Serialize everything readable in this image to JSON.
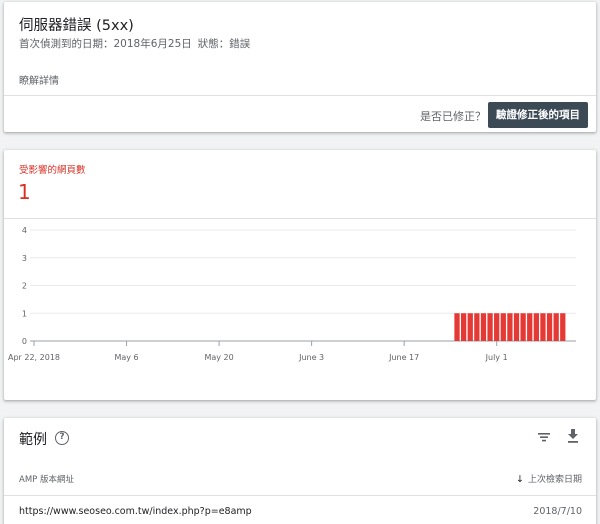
{
  "issue": {
    "title": "伺服器錯誤 (5xx)",
    "first_detected_label": "首次偵測到的日期：",
    "first_detected_date": "2018年6月25日",
    "status_label": "狀態：",
    "status_value": "錯誤",
    "learn_more": "瞭解詳情",
    "fixed_question": "是否已修正？",
    "validate_button": "驗證修正後的項目"
  },
  "stats": {
    "label": "受影響的網頁數",
    "value": "1"
  },
  "chart_data": {
    "type": "bar",
    "series_color": "#e53935",
    "ylim": [
      0,
      4
    ],
    "yticks": [
      "0",
      "1",
      "2",
      "3",
      "4"
    ],
    "xtick_labels": [
      "Apr 22, 2018",
      "May 6",
      "May 20",
      "June 3",
      "June 17",
      "July 1"
    ],
    "day_range": [
      0,
      82
    ],
    "xtick_days": [
      0,
      14,
      28,
      42,
      56,
      70
    ],
    "bars": [
      {
        "day": 64,
        "value": 1
      },
      {
        "day": 65,
        "value": 1
      },
      {
        "day": 66,
        "value": 1
      },
      {
        "day": 67,
        "value": 1
      },
      {
        "day": 68,
        "value": 1
      },
      {
        "day": 69,
        "value": 1
      },
      {
        "day": 70,
        "value": 1
      },
      {
        "day": 71,
        "value": 1
      },
      {
        "day": 72,
        "value": 1
      },
      {
        "day": 73,
        "value": 1
      },
      {
        "day": 74,
        "value": 1
      },
      {
        "day": 75,
        "value": 1
      },
      {
        "day": 76,
        "value": 1
      },
      {
        "day": 77,
        "value": 1
      },
      {
        "day": 78,
        "value": 1
      },
      {
        "day": 79,
        "value": 1
      },
      {
        "day": 80,
        "value": 1
      }
    ],
    "grid": true
  },
  "examples": {
    "title": "範例",
    "help_icon": "help-circle-icon",
    "filter_icon": "filter-icon",
    "download_icon": "download-icon",
    "col_url": "AMP 版本網址",
    "col_date": "上次檢索日期",
    "rows": [
      {
        "url": "https://www.seoseo.com.tw/index.php?p=e8amp",
        "date": "2018/7/10"
      }
    ]
  }
}
